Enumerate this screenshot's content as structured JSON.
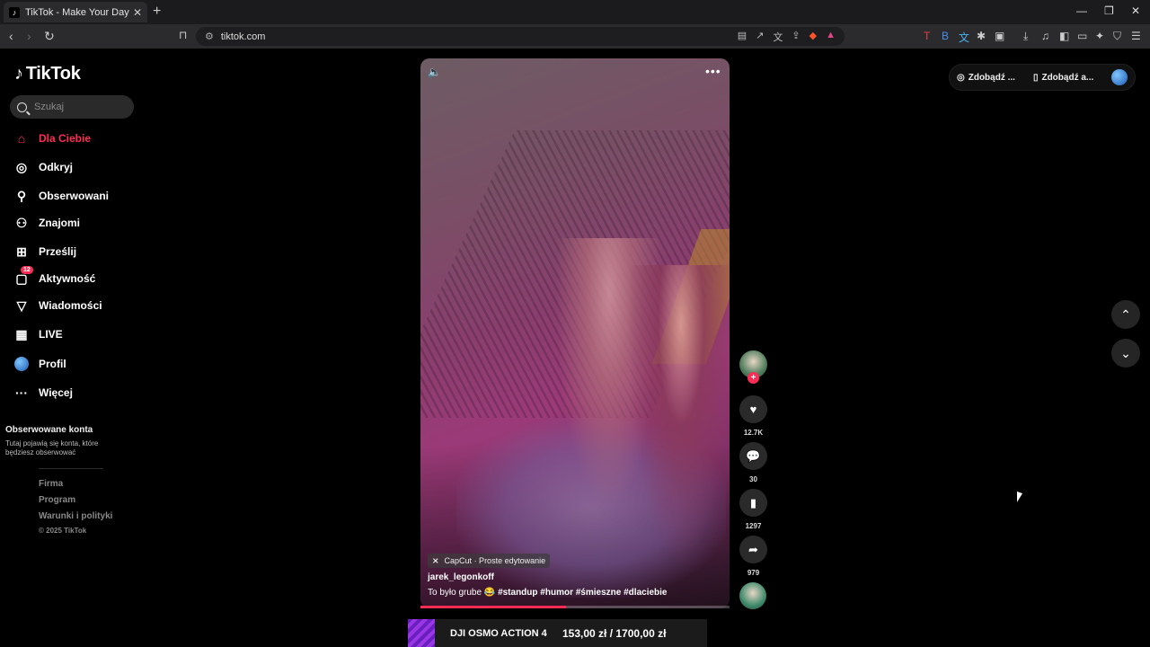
{
  "browser": {
    "tab_title": "TikTok - Make Your Day",
    "url": "tiktok.com",
    "new_tab": "+",
    "min": "—",
    "restore": "❐",
    "close": "✕"
  },
  "brand": {
    "name": "TikTok"
  },
  "search": {
    "placeholder": "Szukaj"
  },
  "nav": [
    {
      "label": "Dla Ciebie",
      "icon": "home-icon"
    },
    {
      "label": "Odkryj",
      "icon": "compass-icon"
    },
    {
      "label": "Obserwowani",
      "icon": "user-follow-icon"
    },
    {
      "label": "Znajomi",
      "icon": "friends-icon"
    },
    {
      "label": "Prześlij",
      "icon": "upload-icon"
    },
    {
      "label": "Aktywność",
      "icon": "inbox-icon",
      "badge": "12"
    },
    {
      "label": "Wiadomości",
      "icon": "send-icon"
    },
    {
      "label": "LIVE",
      "icon": "live-icon"
    },
    {
      "label": "Profil",
      "icon": "profile-avatar"
    },
    {
      "label": "Więcej",
      "icon": "more-icon"
    }
  ],
  "following": {
    "title": "Obserwowane konta",
    "description": "Tutaj pojawią się konta, które będziesz obserwować"
  },
  "footer": {
    "links": [
      "Firma",
      "Program",
      "Warunki i polityki"
    ],
    "copyright": "© 2025 TikTok"
  },
  "video": {
    "capcut": "CapCut · Proste edytowanie",
    "author": "jarek_legonkoff",
    "caption_text": "To było grube 😂",
    "hashtags": [
      "#standup",
      "#humor",
      "#śmieszne",
      "#dlaciebie"
    ],
    "progress": 0.47
  },
  "actions": {
    "likes": "12.7K",
    "comments": "30",
    "saves": "1297",
    "shares": "979"
  },
  "topright": {
    "get_coins": "Zdobądź ...",
    "get_app": "Zdobądź a..."
  },
  "ad": {
    "product": "DJI OSMO ACTION 4",
    "price": "153,00 zł / 1700,00 zł"
  }
}
